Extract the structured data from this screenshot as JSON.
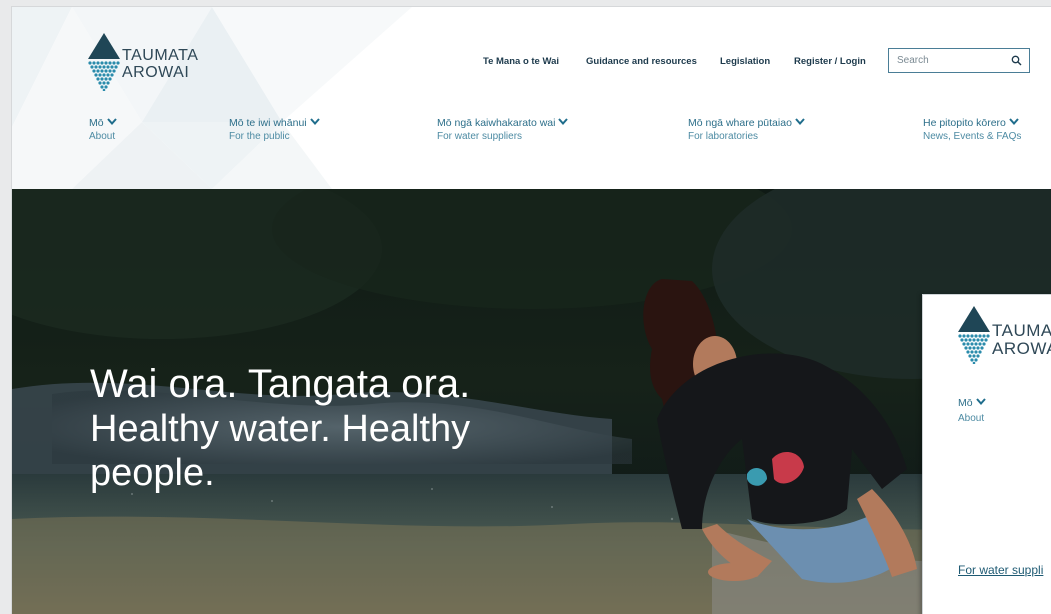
{
  "logo": {
    "line1": "TAUMATA",
    "line2": "AROWAI",
    "colors": {
      "teal": "#2a8bab",
      "dark": "#1f4656"
    }
  },
  "topnav": {
    "items": [
      {
        "label": "Te Mana o te Wai"
      },
      {
        "label": "Guidance and resources"
      },
      {
        "label": "Legislation"
      },
      {
        "label": "Register / Login"
      }
    ]
  },
  "search": {
    "placeholder": "Search",
    "icon": "search-icon"
  },
  "mainnav": {
    "items": [
      {
        "mi": "Mō",
        "en": "About"
      },
      {
        "mi": "Mō te iwi whānui",
        "en": "For the public"
      },
      {
        "mi": "Mō ngā kaiwhakarato wai",
        "en": "For water suppliers"
      },
      {
        "mi": "Mō ngā whare pūtaiao",
        "en": "For laboratories"
      },
      {
        "mi": "He pitopito kōrero",
        "en": "News, Events & FAQs"
      }
    ],
    "chevron_icon": "chevron-down-icon"
  },
  "hero": {
    "headline_mi": "Wai ora. Tangata ora.",
    "headline_en": "Healthy water. Healthy people."
  },
  "overlay_panel": {
    "logo_line1": "TAUMATA",
    "logo_line2": "AROWAI",
    "nav_mi": "Mō",
    "nav_en": "About",
    "link": "For water suppli"
  },
  "colors": {
    "nav_text": "#2d6f8a",
    "top_nav_text": "#1d3a4c",
    "search_border": "#4a7d96"
  }
}
